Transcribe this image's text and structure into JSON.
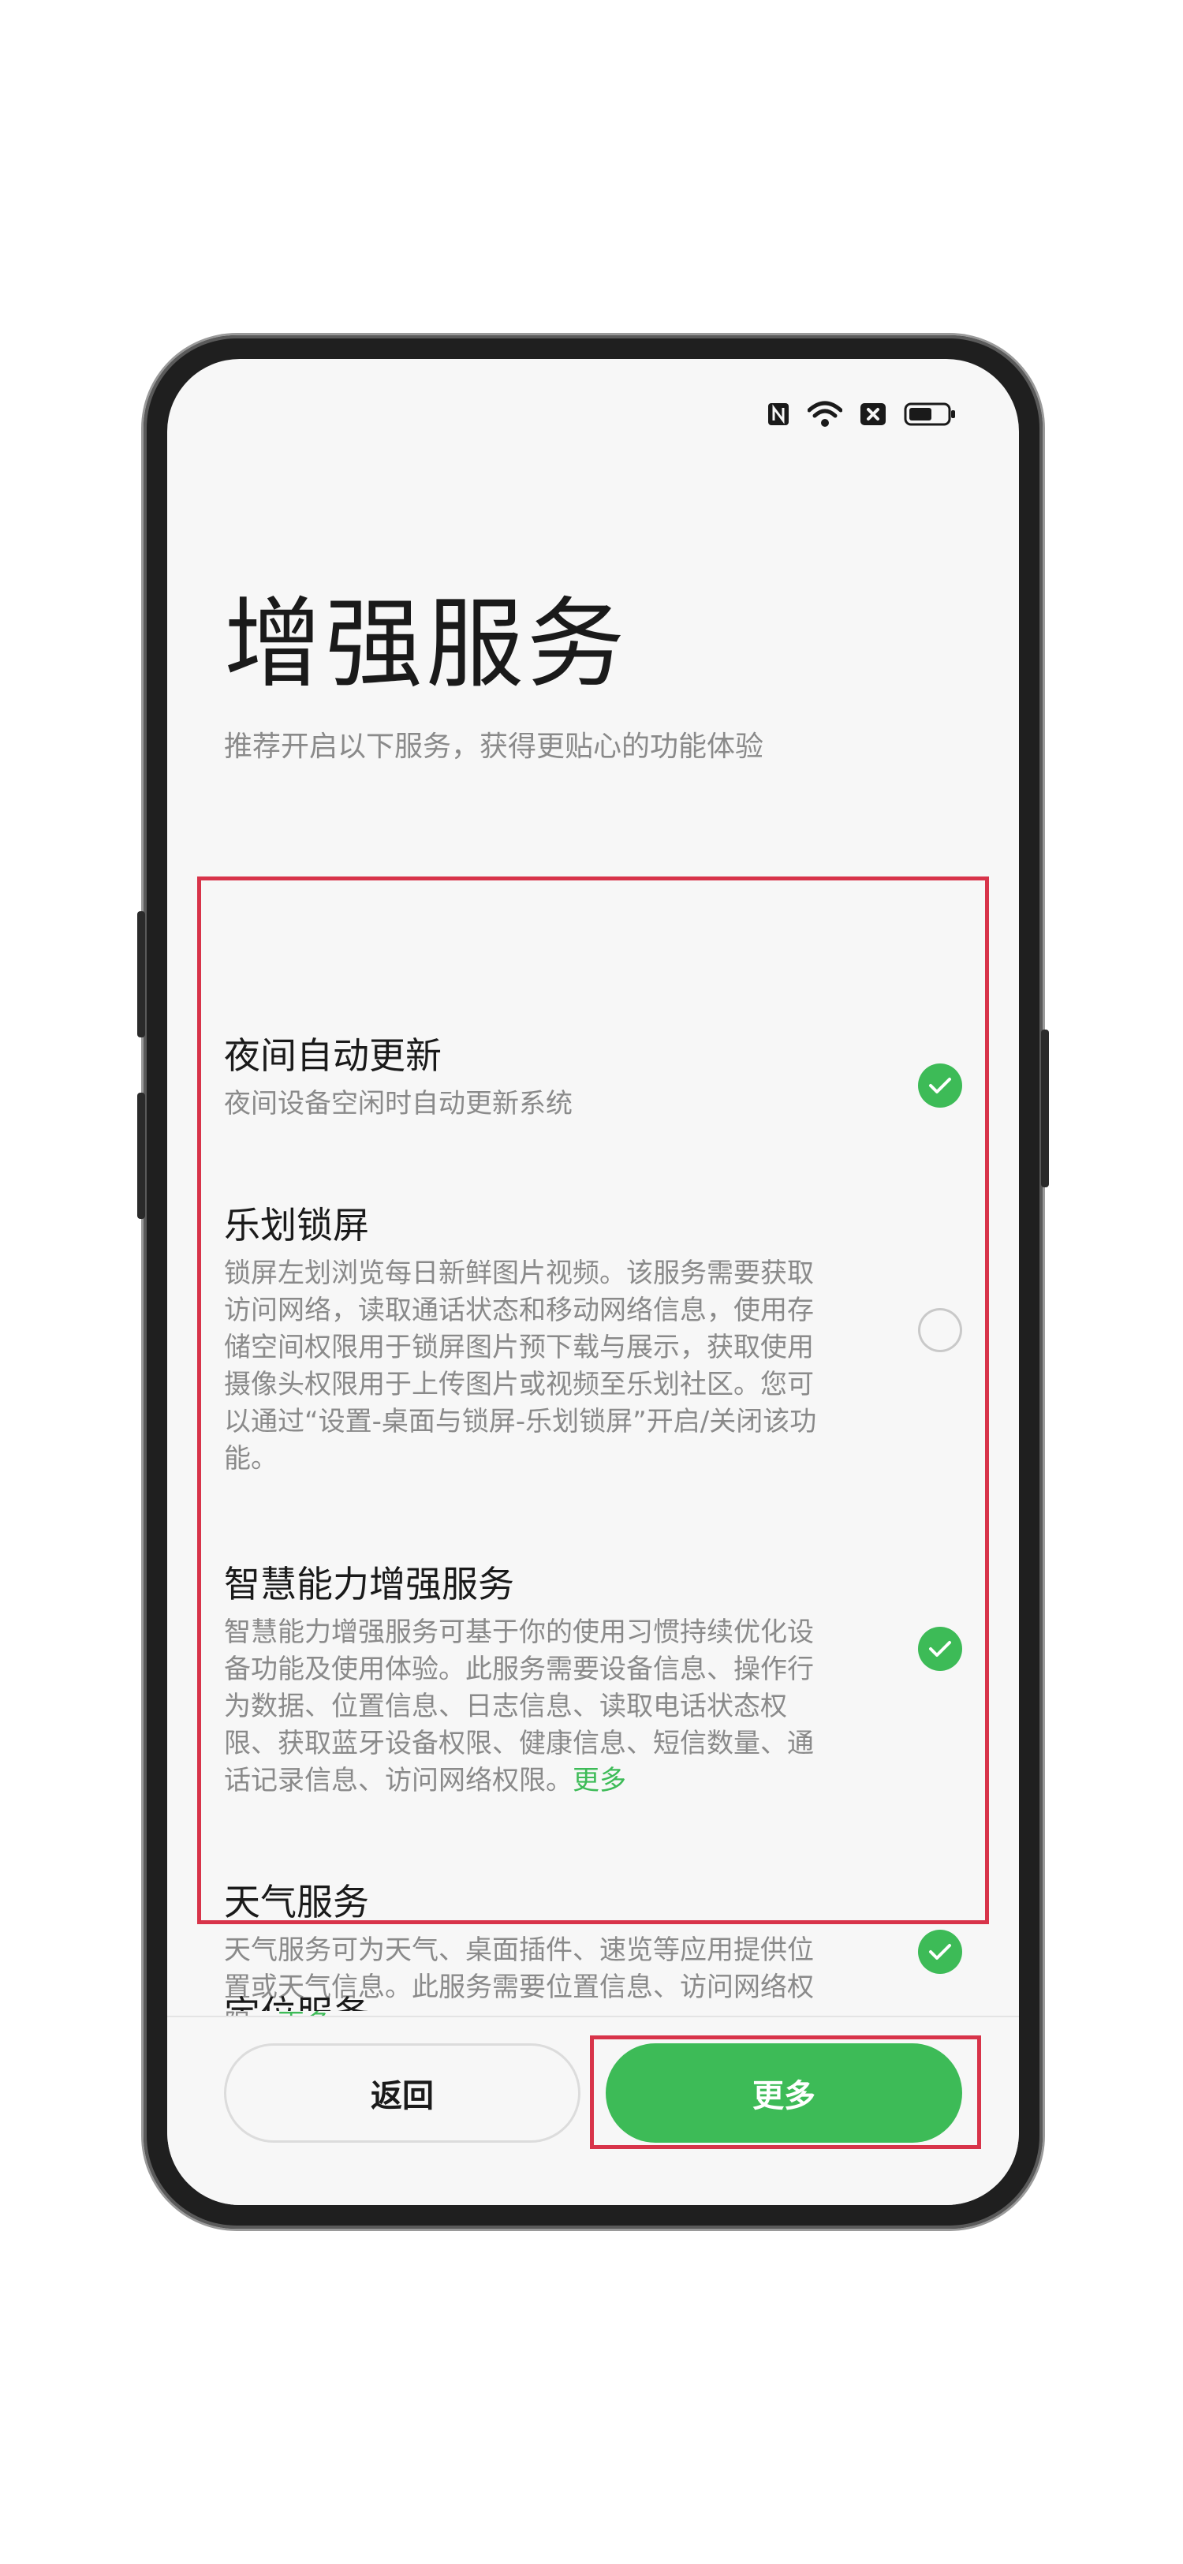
{
  "status_bar": {
    "icons": [
      "nfc-icon",
      "wifi-icon",
      "sim-error-icon",
      "battery-icon"
    ],
    "battery_level_percent": 60
  },
  "header": {
    "title": "增强服务",
    "subtitle": "推荐开启以下服务，获得更贴心的功能体验"
  },
  "services": [
    {
      "title": "夜间自动更新",
      "description": "夜间设备空闲时自动更新系统",
      "more": "",
      "checked": true
    },
    {
      "title": "乐划锁屏",
      "description": "锁屏左划浏览每日新鲜图片视频。该服务需要获取访问网络，读取通话状态和移动网络信息，使用存储空间权限用于锁屏图片预下载与展示，获取使用摄像头权限用于上传图片或视频至乐划社区。您可以通过“设置-桌面与锁屏-乐划锁屏”开启/关闭该功能。",
      "more": "",
      "checked": false
    },
    {
      "title": "智慧能力增强服务",
      "description": "智慧能力增强服务可基于你的使用习惯持续优化设备功能及使用体验。此服务需要设备信息、操作行为数据、位置信息、日志信息、读取电话状态权限、获取蓝牙设备权限、健康信息、短信数量、通话记录信息、访问网络权限。",
      "more": "更多",
      "checked": true
    },
    {
      "title": "天气服务",
      "description": "天气服务可为天气、桌面插件、速览等应用提供位置或天气信息。此服务需要位置信息、访问网络权限。",
      "more": "更多",
      "checked": true
    }
  ],
  "partial_next_section": "定位服务",
  "footer": {
    "back_label": "返回",
    "more_label": "更多"
  },
  "colors": {
    "accent": "#3dbb57",
    "highlight": "#d8344a",
    "title_text": "#1a1a1a",
    "secondary_text": "#8a8a8a"
  }
}
